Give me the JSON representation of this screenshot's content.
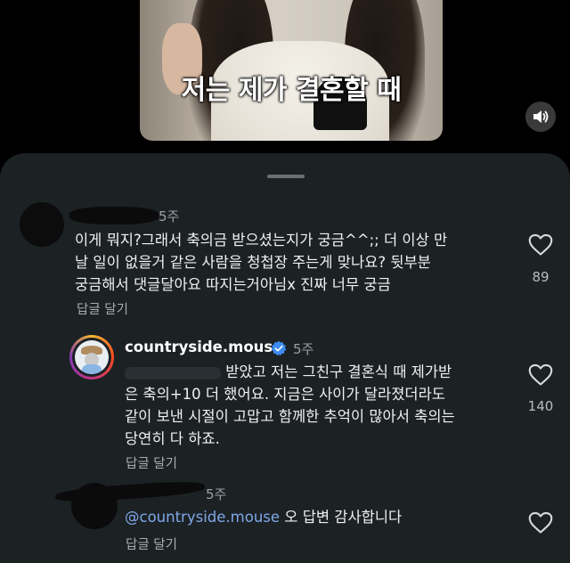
{
  "video": {
    "caption": "저는 제가 결혼할 때",
    "sound_icon": "speaker-icon"
  },
  "comments": [
    {
      "time": "5주",
      "text_lines": [
        "이게 뭐지?그래서 축의금 받으셨는지가 궁금^^;; 더 이상 만",
        "날 일이 없을거 같은 사람을 청첩장 주는게 맞나요? 뒷부분",
        "궁금해서 댓글달아요 따지는거아님x 진짜 너무 궁금"
      ],
      "reply_label": "답글 달기",
      "likes": "89"
    },
    {
      "username": "countryside.mouse",
      "time": "5주",
      "text_lines": [
        "받았고 저는 그친구 결혼식 때 제가받",
        "은 축의+10 더 했어요. 지금은 사이가 달라졌더라도",
        "같이 보낸 시절이 고맙고 함께한 추억이 많아서 축의는",
        "당연히 다 하죠."
      ],
      "reply_label": "답글 달기",
      "likes": "140"
    },
    {
      "time": "5주",
      "mention": "@countryside.mouse",
      "text": " 오 답변 감사합니다",
      "reply_label": "답글 달기"
    }
  ],
  "colors": {
    "sheet_bg": "#1c2124",
    "mention": "#7fa8e8",
    "verified": "#3d8bf2"
  }
}
